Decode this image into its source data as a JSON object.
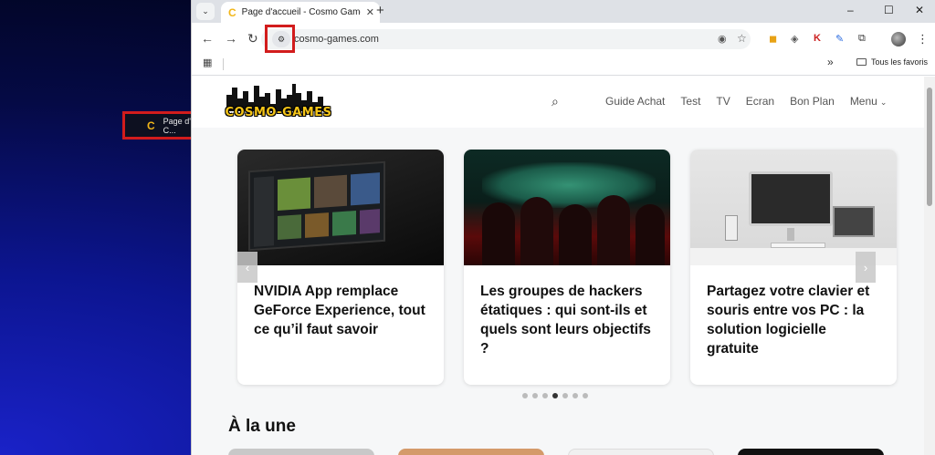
{
  "drag_ghost": {
    "favicon": "C",
    "title": "Page d'accueil - C..."
  },
  "tab": {
    "favicon": "C",
    "title": "Page d'accueil - Cosmo Games",
    "close": "✕"
  },
  "tabstrip": {
    "tab_search": "⌄",
    "new_tab": "+",
    "minimize": "–",
    "maximize": "☐",
    "close": "✕"
  },
  "toolbar": {
    "back": "←",
    "forward": "→",
    "reload": "↻",
    "site_info_icon": "⚙",
    "url": "cosmo-games.com",
    "eye": "◉",
    "star": "☆",
    "menu": "⋮",
    "extensions": [
      "◼",
      "◈",
      "K",
      "✎",
      "⧉"
    ]
  },
  "bookmarks": {
    "apps": "▦",
    "more": "»",
    "folder": "Tous les favoris"
  },
  "site": {
    "logo": "COSMO-GAMES",
    "search": "⌕",
    "nav": [
      "Guide Achat",
      "Test",
      "TV",
      "Ecran",
      "Bon Plan",
      "Menu"
    ],
    "menu_chevron": "⌄"
  },
  "carousel": {
    "cards": [
      {
        "headline": "NVIDIA App remplace GeForce Experience, tout ce qu’il faut savoir"
      },
      {
        "headline": "Les groupes de hackers étatiques : qui sont-ils et quels sont leurs objectifs ?"
      },
      {
        "headline": "Partagez votre clavier et souris entre vos PC : la solution logicielle gratuite"
      }
    ],
    "prev": "‹",
    "next": "›",
    "dot_count": 7,
    "active_dot": 3
  },
  "section": {
    "title": "À la une"
  },
  "colors": {
    "highlight": "#d21c1c",
    "logo_yellow": "#f5c518",
    "favicon": "#f2b619"
  }
}
